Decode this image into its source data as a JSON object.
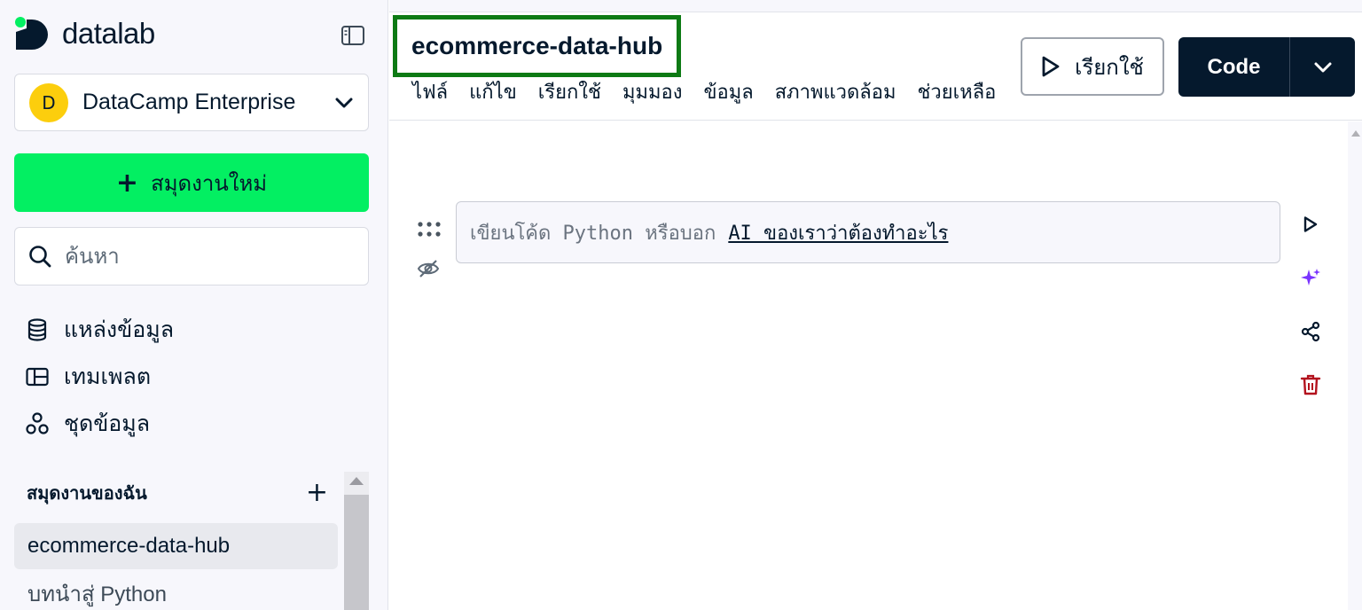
{
  "app": {
    "logo_text": "datalab"
  },
  "sidebar": {
    "org": {
      "avatar_letter": "D",
      "name": "DataCamp Enterprise"
    },
    "new_notebook_label": "สมุดงานใหม่",
    "search": {
      "placeholder": "ค้นหา",
      "value": ""
    },
    "nav": [
      {
        "label": "แหล่งข้อมูล",
        "icon": "database-icon"
      },
      {
        "label": "เทมเพลต",
        "icon": "template-icon"
      },
      {
        "label": "ชุดข้อมูล",
        "icon": "dataset-icon"
      }
    ],
    "section_title": "สมุดงานของฉัน",
    "notebooks": [
      {
        "label": "ecommerce-data-hub",
        "active": true
      },
      {
        "label": "บทนำสู่ Python",
        "active": false
      }
    ]
  },
  "header": {
    "title": "ecommerce-data-hub",
    "menu": [
      "ไฟล์",
      "แก้ไข",
      "เรียกใช้",
      "มุมมอง",
      "ข้อมูล",
      "สภาพแวดล้อม",
      "ช่วยเหลือ"
    ],
    "run_label": "เรียกใช้",
    "code_label": "Code"
  },
  "cell": {
    "placeholder_prefix": "เขียนโค้ด Python หรือบอก",
    "ai_link": "AI ของเราว่าต้องทำอะไร"
  },
  "colors": {
    "brand_green": "#03ef62",
    "navy": "#05192d",
    "title_highlight": "#0d7a14",
    "avatar_yellow": "#fcce0d",
    "ai_purple": "#7933ff",
    "delete_red": "#b3121e"
  }
}
